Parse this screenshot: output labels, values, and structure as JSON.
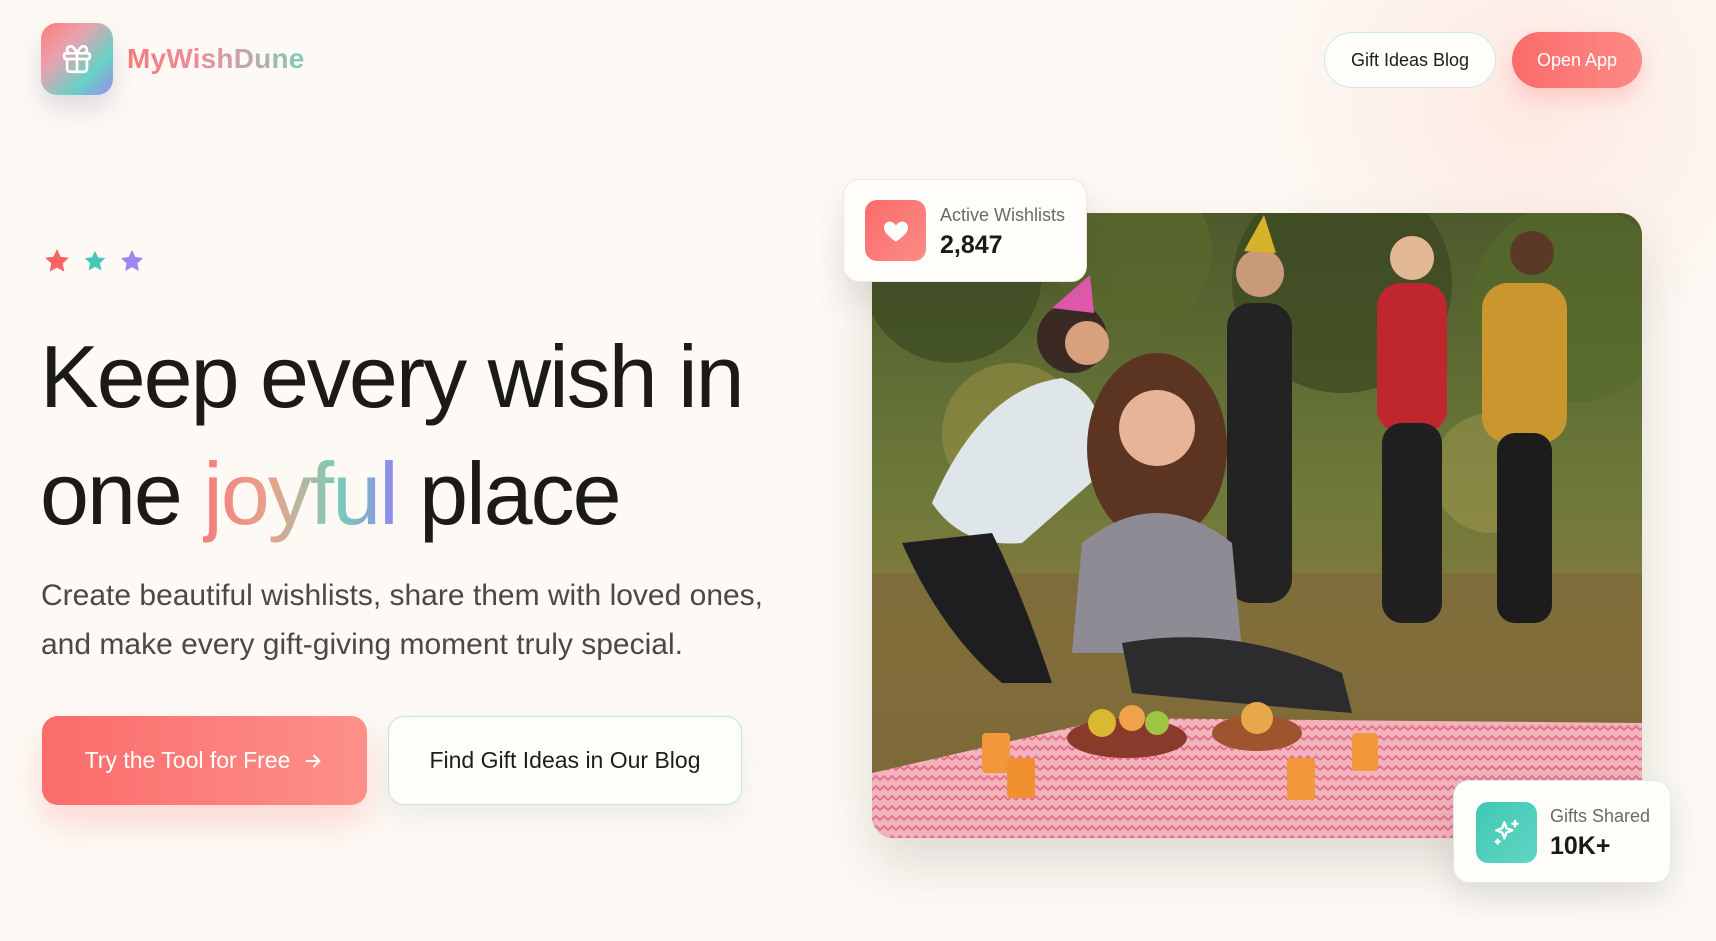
{
  "header": {
    "brand": "MyWishDune",
    "logo_icon": "gift-icon",
    "nav_blog_label": "Gift Ideas Blog",
    "nav_open_label": "Open App"
  },
  "hero": {
    "stars": [
      {
        "icon": "star-icon",
        "color": "#f76464"
      },
      {
        "icon": "star-icon",
        "color": "#45c7b6"
      },
      {
        "icon": "star-icon",
        "color": "#9b86f2"
      }
    ],
    "headline_line1": "Keep every wish in",
    "headline_pre": "one ",
    "headline_accent": "joyful",
    "headline_post": " place",
    "subtitle": "Create beautiful wishlists, share them with loved ones, and make every gift-giving moment truly special.",
    "cta_primary_label": "Try the Tool for Free",
    "cta_primary_icon": "arrow-right-icon",
    "cta_secondary_label": "Find Gift Ideas in Our Blog"
  },
  "stats": [
    {
      "label": "Active Wishlists",
      "value": "2,847",
      "icon": "heart-icon",
      "color": "#fb6b6b"
    },
    {
      "label": "Gifts Shared",
      "value": "10K+",
      "icon": "sparkle-icon",
      "color": "#45c7b6"
    }
  ],
  "colors": {
    "coral": "#fb6b6b",
    "teal": "#45c7b6",
    "purple": "#9b86f2",
    "background": "#fdfaf5"
  }
}
